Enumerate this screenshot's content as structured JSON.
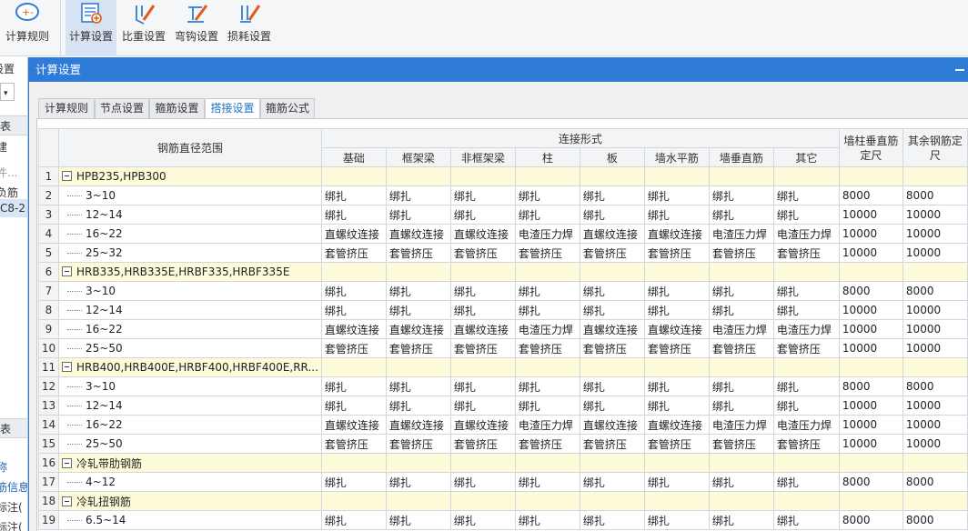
{
  "ribbon": {
    "buttons": [
      {
        "label": "计算规则",
        "icon": "calc-rule-icon"
      },
      {
        "label": "计算设置",
        "icon": "calc-settings-icon"
      },
      {
        "label": "比重设置",
        "icon": "weight-settings-icon"
      },
      {
        "label": "弯钩设置",
        "icon": "hook-settings-icon"
      },
      {
        "label": "损耗设置",
        "icon": "loss-settings-icon"
      }
    ]
  },
  "left_panel": {
    "items": [
      "设置",
      "表",
      "建",
      "件...",
      "负筋",
      "C8-2",
      "表",
      "称",
      "筋信息",
      "标注(",
      "标注("
    ]
  },
  "dialog": {
    "title": "计算设置",
    "tabs": [
      "计算规则",
      "节点设置",
      "箍筋设置",
      "搭接设置",
      "箍筋公式"
    ],
    "active_tab": 3
  },
  "grid": {
    "header": {
      "range": "钢筋直径范围",
      "connection_group": "连接形式",
      "sub": [
        "基础",
        "框架梁",
        "非框架梁",
        "柱",
        "板",
        "墙水平筋",
        "墙垂直筋",
        "其它"
      ],
      "wall_vertical_length": "墙柱垂直筋定尺",
      "other_length": "其余钢筋定尺"
    },
    "rows": [
      {
        "n": "1",
        "group": true,
        "label": "HPB235,HPB300"
      },
      {
        "n": "2",
        "label": "3~10",
        "c": [
          "绑扎",
          "绑扎",
          "绑扎",
          "绑扎",
          "绑扎",
          "绑扎",
          "绑扎",
          "绑扎"
        ],
        "l1": "8000",
        "l2": "8000"
      },
      {
        "n": "3",
        "label": "12~14",
        "c": [
          "绑扎",
          "绑扎",
          "绑扎",
          "绑扎",
          "绑扎",
          "绑扎",
          "绑扎",
          "绑扎"
        ],
        "l1": "10000",
        "l2": "10000"
      },
      {
        "n": "4",
        "label": "16~22",
        "c": [
          "直螺纹连接",
          "直螺纹连接",
          "直螺纹连接",
          "电渣压力焊",
          "直螺纹连接",
          "直螺纹连接",
          "电渣压力焊",
          "电渣压力焊"
        ],
        "l1": "10000",
        "l2": "10000"
      },
      {
        "n": "5",
        "label": "25~32",
        "c": [
          "套管挤压",
          "套管挤压",
          "套管挤压",
          "套管挤压",
          "套管挤压",
          "套管挤压",
          "套管挤压",
          "套管挤压"
        ],
        "l1": "10000",
        "l2": "10000"
      },
      {
        "n": "6",
        "group": true,
        "label": "HRB335,HRB335E,HRBF335,HRBF335E"
      },
      {
        "n": "7",
        "label": "3~10",
        "c": [
          "绑扎",
          "绑扎",
          "绑扎",
          "绑扎",
          "绑扎",
          "绑扎",
          "绑扎",
          "绑扎"
        ],
        "l1": "8000",
        "l2": "8000"
      },
      {
        "n": "8",
        "label": "12~14",
        "c": [
          "绑扎",
          "绑扎",
          "绑扎",
          "绑扎",
          "绑扎",
          "绑扎",
          "绑扎",
          "绑扎"
        ],
        "l1": "10000",
        "l2": "10000"
      },
      {
        "n": "9",
        "label": "16~22",
        "c": [
          "直螺纹连接",
          "直螺纹连接",
          "直螺纹连接",
          "电渣压力焊",
          "直螺纹连接",
          "直螺纹连接",
          "电渣压力焊",
          "电渣压力焊"
        ],
        "l1": "10000",
        "l2": "10000"
      },
      {
        "n": "10",
        "label": "25~50",
        "c": [
          "套管挤压",
          "套管挤压",
          "套管挤压",
          "套管挤压",
          "套管挤压",
          "套管挤压",
          "套管挤压",
          "套管挤压"
        ],
        "l1": "10000",
        "l2": "10000"
      },
      {
        "n": "11",
        "group": true,
        "label": "HRB400,HRB400E,HRBF400,HRBF400E,RR..."
      },
      {
        "n": "12",
        "label": "3~10",
        "c": [
          "绑扎",
          "绑扎",
          "绑扎",
          "绑扎",
          "绑扎",
          "绑扎",
          "绑扎",
          "绑扎"
        ],
        "l1": "8000",
        "l2": "8000"
      },
      {
        "n": "13",
        "label": "12~14",
        "c": [
          "绑扎",
          "绑扎",
          "绑扎",
          "绑扎",
          "绑扎",
          "绑扎",
          "绑扎",
          "绑扎"
        ],
        "l1": "10000",
        "l2": "10000"
      },
      {
        "n": "14",
        "label": "16~22",
        "c": [
          "直螺纹连接",
          "直螺纹连接",
          "直螺纹连接",
          "电渣压力焊",
          "直螺纹连接",
          "直螺纹连接",
          "电渣压力焊",
          "电渣压力焊"
        ],
        "l1": "10000",
        "l2": "10000"
      },
      {
        "n": "15",
        "label": "25~50",
        "c": [
          "套管挤压",
          "套管挤压",
          "套管挤压",
          "套管挤压",
          "套管挤压",
          "套管挤压",
          "套管挤压",
          "套管挤压"
        ],
        "l1": "10000",
        "l2": "10000"
      },
      {
        "n": "16",
        "group": true,
        "label": "冷轧带肋钢筋"
      },
      {
        "n": "17",
        "label": "4~12",
        "c": [
          "绑扎",
          "绑扎",
          "绑扎",
          "绑扎",
          "绑扎",
          "绑扎",
          "绑扎",
          "绑扎"
        ],
        "l1": "8000",
        "l2": "8000"
      },
      {
        "n": "18",
        "group": true,
        "label": "冷轧扭钢筋"
      },
      {
        "n": "19",
        "label": "6.5~14",
        "c": [
          "绑扎",
          "绑扎",
          "绑扎",
          "绑扎",
          "绑扎",
          "绑扎",
          "绑扎",
          "绑扎"
        ],
        "l1": "8000",
        "l2": "8000"
      }
    ]
  },
  "colors": {
    "accent": "#2f7bd8",
    "group_row": "#fdfbd9",
    "header_bg": "#f3f4f6"
  }
}
